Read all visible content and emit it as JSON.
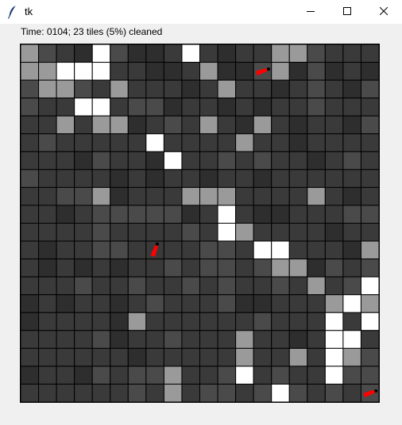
{
  "window": {
    "title": "tk",
    "icon": "feather-icon",
    "controls": [
      "minimize-icon",
      "maximize-icon",
      "close-icon"
    ]
  },
  "status": {
    "text": "Time: 0104; 23 tiles (5%) cleaned"
  },
  "grid": {
    "rows": 20,
    "cols": 20,
    "palette": {
      "0": "#2e2e2e",
      "1": "#3a3a3a",
      "2": "#4a4a4a",
      "3": "#5c5c5c",
      "4": "#9a9a9a",
      "5": "#ffffff"
    },
    "grid_line_color": "#000000",
    "robot_color": "#ff0000",
    "cells": [
      [
        4,
        2,
        1,
        0,
        5,
        2,
        0,
        0,
        1,
        5,
        1,
        0,
        1,
        1,
        4,
        4,
        2,
        1,
        1,
        1
      ],
      [
        4,
        4,
        5,
        5,
        5,
        1,
        1,
        0,
        0,
        1,
        4,
        0,
        0,
        2,
        4,
        0,
        2,
        0,
        1,
        0
      ],
      [
        2,
        4,
        4,
        2,
        1,
        4,
        1,
        1,
        1,
        0,
        1,
        4,
        1,
        1,
        0,
        1,
        2,
        1,
        0,
        2
      ],
      [
        2,
        1,
        1,
        5,
        5,
        1,
        2,
        2,
        0,
        1,
        1,
        0,
        1,
        0,
        1,
        1,
        2,
        1,
        1,
        1
      ],
      [
        1,
        1,
        4,
        1,
        4,
        4,
        0,
        1,
        2,
        1,
        4,
        1,
        0,
        4,
        1,
        0,
        1,
        1,
        0,
        2
      ],
      [
        1,
        2,
        1,
        1,
        1,
        1,
        1,
        5,
        1,
        1,
        1,
        1,
        4,
        1,
        1,
        0,
        1,
        1,
        1,
        1
      ],
      [
        1,
        1,
        1,
        0,
        2,
        1,
        1,
        0,
        5,
        1,
        1,
        2,
        1,
        2,
        1,
        1,
        0,
        1,
        2,
        1
      ],
      [
        2,
        1,
        1,
        1,
        1,
        0,
        1,
        0,
        1,
        1,
        0,
        1,
        1,
        0,
        1,
        1,
        1,
        1,
        1,
        1
      ],
      [
        1,
        1,
        2,
        2,
        4,
        0,
        1,
        1,
        1,
        4,
        4,
        4,
        1,
        1,
        1,
        1,
        4,
        1,
        0,
        1
      ],
      [
        1,
        1,
        0,
        1,
        2,
        2,
        2,
        2,
        2,
        0,
        1,
        5,
        1,
        0,
        0,
        1,
        1,
        1,
        2,
        2
      ],
      [
        1,
        1,
        1,
        1,
        2,
        1,
        1,
        1,
        1,
        2,
        1,
        5,
        4,
        1,
        1,
        1,
        1,
        0,
        1,
        1
      ],
      [
        1,
        0,
        1,
        1,
        2,
        2,
        1,
        1,
        1,
        1,
        2,
        2,
        1,
        5,
        5,
        1,
        1,
        1,
        0,
        4
      ],
      [
        1,
        0,
        1,
        0,
        1,
        0,
        1,
        1,
        2,
        1,
        2,
        2,
        1,
        2,
        4,
        4,
        0,
        2,
        1,
        2
      ],
      [
        1,
        1,
        1,
        2,
        1,
        1,
        2,
        1,
        1,
        2,
        1,
        2,
        1,
        1,
        2,
        1,
        4,
        1,
        2,
        5
      ],
      [
        0,
        1,
        0,
        1,
        1,
        0,
        1,
        2,
        1,
        1,
        1,
        2,
        0,
        0,
        1,
        1,
        1,
        4,
        5,
        4
      ],
      [
        0,
        1,
        1,
        1,
        1,
        0,
        4,
        1,
        1,
        1,
        1,
        1,
        1,
        2,
        1,
        1,
        1,
        5,
        1,
        5
      ],
      [
        1,
        1,
        1,
        1,
        2,
        0,
        1,
        1,
        2,
        1,
        1,
        1,
        4,
        1,
        1,
        0,
        1,
        5,
        5,
        1
      ],
      [
        1,
        1,
        1,
        1,
        1,
        1,
        0,
        1,
        1,
        1,
        1,
        1,
        4,
        1,
        1,
        4,
        1,
        5,
        4,
        2
      ],
      [
        0,
        1,
        1,
        0,
        2,
        1,
        2,
        2,
        4,
        1,
        1,
        2,
        5,
        1,
        2,
        1,
        1,
        5,
        2,
        2
      ],
      [
        1,
        1,
        1,
        1,
        1,
        1,
        2,
        1,
        4,
        1,
        2,
        2,
        1,
        2,
        5,
        2,
        1,
        2,
        1,
        2
      ]
    ],
    "robots": [
      {
        "name": "robot-1",
        "row": 1,
        "col": 13,
        "heading": "right"
      },
      {
        "name": "robot-2",
        "row": 11,
        "col": 7,
        "heading": "up"
      },
      {
        "name": "robot-3",
        "row": 19,
        "col": 19,
        "heading": "right"
      }
    ]
  }
}
